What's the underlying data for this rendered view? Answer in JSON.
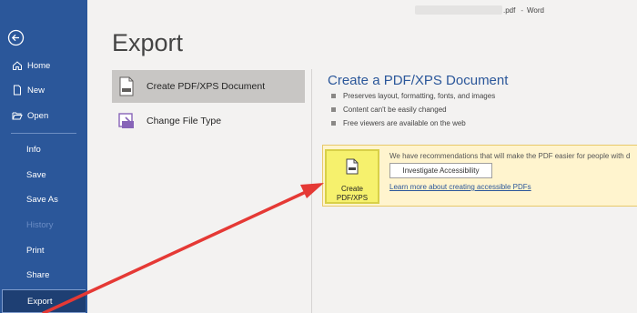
{
  "titlebar": {
    "filename_suffix": ".pdf",
    "separator": "-",
    "app_name": "Word"
  },
  "sidebar": {
    "items": [
      {
        "label": "Home"
      },
      {
        "label": "New"
      },
      {
        "label": "Open"
      },
      {
        "label": "Info"
      },
      {
        "label": "Save"
      },
      {
        "label": "Save As"
      },
      {
        "label": "History"
      },
      {
        "label": "Print"
      },
      {
        "label": "Share"
      },
      {
        "label": "Export"
      }
    ]
  },
  "page": {
    "title": "Export"
  },
  "export_options": [
    {
      "label": "Create PDF/XPS Document"
    },
    {
      "label": "Change File Type"
    }
  ],
  "pane": {
    "title": "Create a PDF/XPS Document",
    "bullets": [
      "Preserves layout, formatting, fonts, and images",
      "Content can't be easily changed",
      "Free viewers are available on the web"
    ]
  },
  "recommendation": {
    "text": "We have recommendations that will make the PDF easier for people with d",
    "button": "Investigate Accessibility",
    "link": "Learn more about creating accessible PDFs"
  },
  "create_button": {
    "line1": "Create",
    "line2": "PDF/XPS"
  },
  "colors": {
    "sidebar": "#2b579a",
    "selected": "#1e3f73",
    "highlight": "#f6f16d",
    "rec_bg": "#fff4ce",
    "arrow": "#e53935"
  }
}
